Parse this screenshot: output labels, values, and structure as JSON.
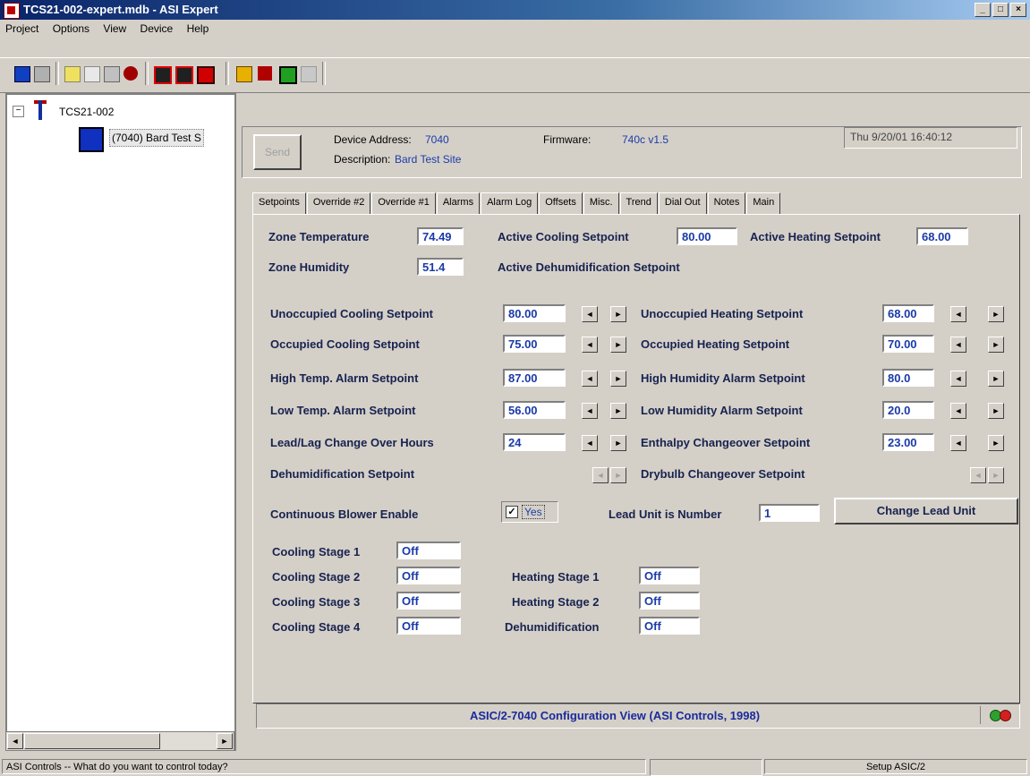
{
  "window": {
    "title": "TCS21-002-expert.mdb - ASI Expert",
    "min": "_",
    "max": "□",
    "close": "×"
  },
  "menu": [
    "Project",
    "Options",
    "View",
    "Device",
    "Help"
  ],
  "toolbar_icons": [
    "display-icon",
    "printer-icon",
    "document-icon",
    "chart-icon",
    "find-icon",
    "record-icon",
    "save-icon",
    "save-all-icon",
    "save-red-icon",
    "home-icon",
    "ti-logo-icon",
    "monitor-icon",
    "disabled-icon"
  ],
  "tree": {
    "root": "TCS21-002",
    "child": "(7040) Bard Test S",
    "expander": "−"
  },
  "tree_scroll": {
    "left": "◄",
    "right": "►"
  },
  "device": {
    "send_label": "Send",
    "address_label": "Device Address:",
    "address_value": "7040",
    "firmware_label": "Firmware:",
    "firmware_value": "740c v1.5",
    "description_label": "Description:",
    "description_value": "Bard Test Site",
    "datetime": "Thu 9/20/01 16:40:12"
  },
  "tabs": [
    "Setpoints",
    "Override #2",
    "Override #1",
    "Alarms",
    "Alarm Log",
    "Offsets",
    "Misc.",
    "Trend",
    "Dial Out",
    "Notes",
    "Main"
  ],
  "status_top": {
    "zone_temp_label": "Zone Temperature",
    "zone_temp": "74.49",
    "active_cool_label": "Active Cooling Setpoint",
    "active_cool": "80.00",
    "active_heat_label": "Active Heating Setpoint",
    "active_heat": "68.00",
    "zone_humidity_label": "Zone Humidity",
    "zone_humidity": "51.4",
    "active_dehum_label": "Active Dehumidification Setpoint"
  },
  "setpoints_left": [
    {
      "label": "Unoccupied Cooling Setpoint",
      "value": "80.00"
    },
    {
      "label": "Occupied Cooling Setpoint",
      "value": "75.00"
    },
    {
      "label": "High Temp. Alarm Setpoint",
      "value": "87.00"
    },
    {
      "label": "Low Temp. Alarm Setpoint",
      "value": "56.00"
    },
    {
      "label": "Lead/Lag Change Over Hours",
      "value": "24"
    },
    {
      "label": "Dehumidification Setpoint",
      "value": ""
    }
  ],
  "setpoints_right": [
    {
      "label": "Unoccupied Heating Setpoint",
      "value": "68.00"
    },
    {
      "label": "Occupied Heating Setpoint",
      "value": "70.00"
    },
    {
      "label": "High Humidity Alarm Setpoint",
      "value": "80.0"
    },
    {
      "label": "Low Humidity Alarm Setpoint",
      "value": "20.0"
    },
    {
      "label": "Enthalpy Changeover Setpoint",
      "value": "23.00"
    },
    {
      "label": "Drybulb Changeover Setpoint",
      "value": ""
    }
  ],
  "arrows": {
    "left": "◄",
    "right": "►"
  },
  "blower": {
    "label": "Continuous Blower Enable",
    "checked": "✓",
    "value": "Yes"
  },
  "lead_unit": {
    "label": "Lead Unit is Number",
    "value": "1",
    "button": "Change Lead Unit"
  },
  "stages_cooling": [
    {
      "label": "Cooling Stage 1",
      "value": "Off"
    },
    {
      "label": "Cooling Stage 2",
      "value": "Off"
    },
    {
      "label": "Cooling Stage 3",
      "value": "Off"
    },
    {
      "label": "Cooling Stage 4",
      "value": "Off"
    }
  ],
  "stages_other": [
    {
      "label": "Heating Stage 1",
      "value": "Off"
    },
    {
      "label": "Heating Stage 2",
      "value": "Off"
    },
    {
      "label": "Dehumidification",
      "value": "Off"
    }
  ],
  "footer": {
    "caption": "ASIC/2-7040 Configuration View (ASI Controls, 1998)"
  },
  "statusbar": {
    "left": "ASI Controls -- What do you want to control today?",
    "right": "Setup ASIC/2"
  },
  "colors": {
    "title_start": "#0a246a",
    "value_text": "#1a3aa8",
    "label_text": "#18224f",
    "led_green": "#2ea02e",
    "led_red": "#d42020"
  }
}
